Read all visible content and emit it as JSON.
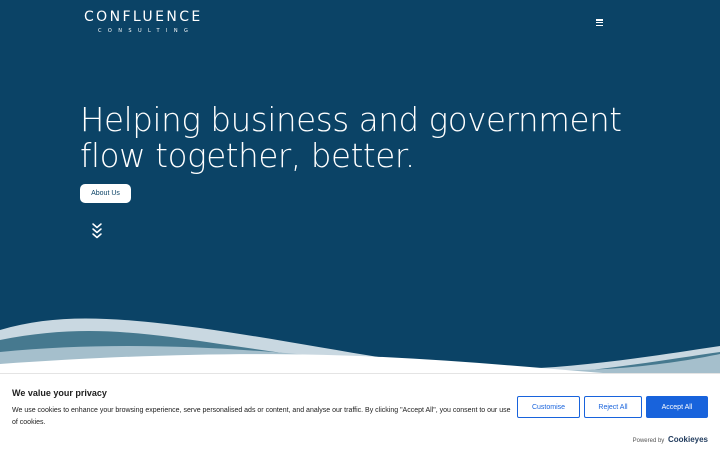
{
  "brand": {
    "name": "CONFLUENCE",
    "tagline": "CONSULTING"
  },
  "hero": {
    "headline_line1": "Helping business and government",
    "headline_line2": "flow together, better.",
    "about_button": "About Us"
  },
  "icons": {
    "menu": "hamburger-menu-icon",
    "scroll": "triple-chevron-down-icon"
  },
  "cookie_banner": {
    "title": "We value your privacy",
    "text": "We use cookies to enhance your browsing experience, serve personalised ads or content, and analyse our traffic. By clicking \"Accept All\", you consent to our use of cookies.",
    "customise_label": "Customise",
    "reject_label": "Reject All",
    "accept_label": "Accept All",
    "powered_by": "Powered by",
    "powered_brand": "Cookieyes"
  },
  "colors": {
    "hero_bg": "#0b4366",
    "accent_blue": "#1863dc",
    "wave_light": "#c9d8e1",
    "wave_mid": "#46798f",
    "wave_pale": "#a5bfcc"
  }
}
